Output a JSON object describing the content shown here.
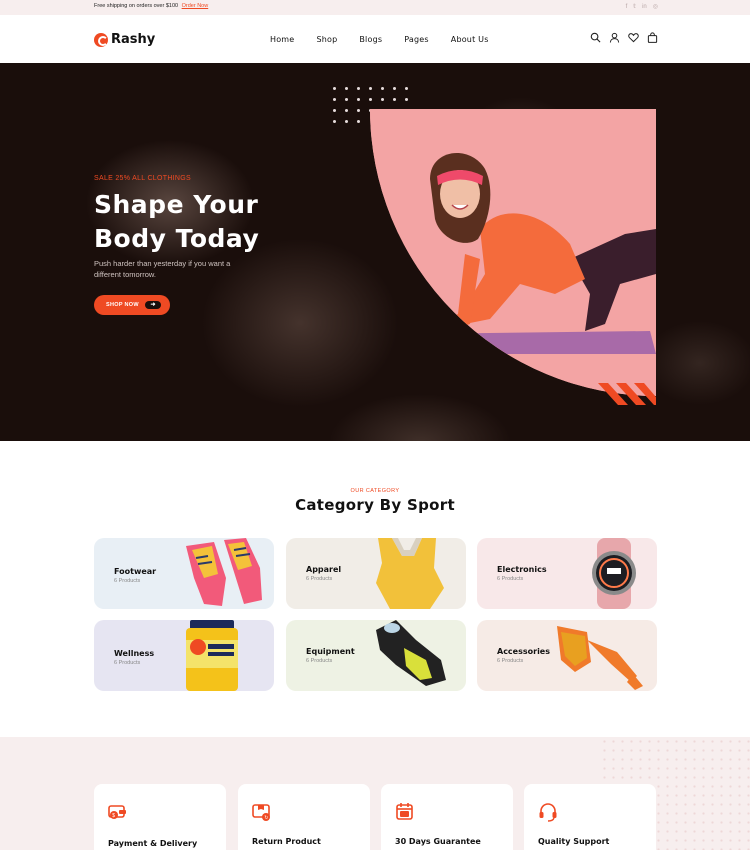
{
  "topbar": {
    "promo_text": "Free shipping on orders over $100",
    "promo_link": "Order Now",
    "socials": [
      "facebook-icon",
      "twitter-icon",
      "linkedin-icon",
      "instagram-icon"
    ]
  },
  "header": {
    "logo": "Rashy",
    "nav": [
      "Home",
      "Shop",
      "Blogs",
      "Pages",
      "About Us"
    ],
    "icons": [
      "search-icon",
      "user-icon",
      "heart-icon",
      "bag-icon"
    ]
  },
  "hero": {
    "eyebrow": "SALE 25% ALL CLOTHINGS",
    "title_line1": "Shape Your",
    "title_line2": "Body Today",
    "subtitle": "Push harder than yesterday if you want a different tomorrow.",
    "button": "SHOP NOW"
  },
  "category": {
    "eyebrow": "OUR CATEGORY",
    "title": "Category By Sport",
    "items": [
      {
        "name": "Footwear",
        "count": "6 Products"
      },
      {
        "name": "Apparel",
        "count": "6 Products"
      },
      {
        "name": "Electronics",
        "count": "6 Products"
      },
      {
        "name": "Wellness",
        "count": "6 Products"
      },
      {
        "name": "Equipment",
        "count": "6 Products"
      },
      {
        "name": "Accessories",
        "count": "6 Products"
      }
    ]
  },
  "features": [
    {
      "title": "Payment & Delivery"
    },
    {
      "title": "Return Product"
    },
    {
      "title": "30 Days Guarantee"
    },
    {
      "title": "Quality Support"
    }
  ],
  "colors": {
    "accent": "#ef4a23",
    "hero_bg": "#1a0e0b",
    "hero_image_bg": "#f3a4a4",
    "topbar_bg": "#f7eeee"
  }
}
